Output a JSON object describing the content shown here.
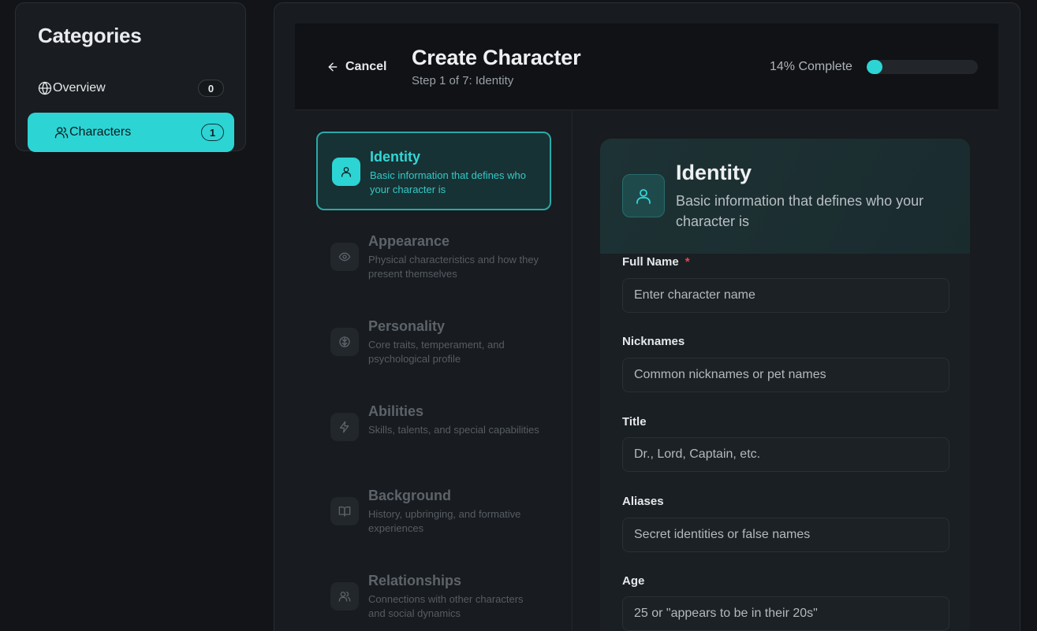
{
  "sidebar": {
    "title": "Categories",
    "items": [
      {
        "label": "Overview",
        "count": "0",
        "icon": "globe-icon"
      },
      {
        "label": "Characters",
        "count": "1",
        "icon": "users-icon"
      }
    ]
  },
  "header": {
    "cancel_label": "Cancel",
    "title": "Create Character",
    "step_text": "Step 1 of 7: Identity",
    "progress_label": "14% Complete",
    "progress_percent": 14
  },
  "steps": [
    {
      "title": "Identity",
      "description": "Basic information that defines who your character is",
      "icon": "user-icon",
      "active": true
    },
    {
      "title": "Appearance",
      "description": "Physical characteristics and how they present themselves",
      "icon": "eye-icon",
      "active": false
    },
    {
      "title": "Personality",
      "description": "Core traits, temperament, and psychological profile",
      "icon": "brain-icon",
      "active": false
    },
    {
      "title": "Abilities",
      "description": "Skills, talents, and special capabilities",
      "icon": "lightning-icon",
      "active": false
    },
    {
      "title": "Background",
      "description": "History, upbringing, and formative experiences",
      "icon": "book-icon",
      "active": false
    },
    {
      "title": "Relationships",
      "description": "Connections with other characters and social dynamics",
      "icon": "users-icon",
      "active": false
    }
  ],
  "form": {
    "title": "Identity",
    "description": "Basic information that defines who your character is",
    "fields": [
      {
        "label": "Full Name",
        "required": "*",
        "placeholder": "Enter character name"
      },
      {
        "label": "Nicknames",
        "placeholder": "Common nicknames or pet names"
      },
      {
        "label": "Title",
        "placeholder": "Dr., Lord, Captain, etc."
      },
      {
        "label": "Aliases",
        "placeholder": "Secret identities or false names"
      },
      {
        "label": "Age",
        "placeholder": "25 or \"appears to be in their 20s\""
      }
    ]
  },
  "colors": {
    "accent": "#2dd4d4",
    "background": "#121418",
    "panel": "#181b1f",
    "required": "#e24a4a"
  }
}
